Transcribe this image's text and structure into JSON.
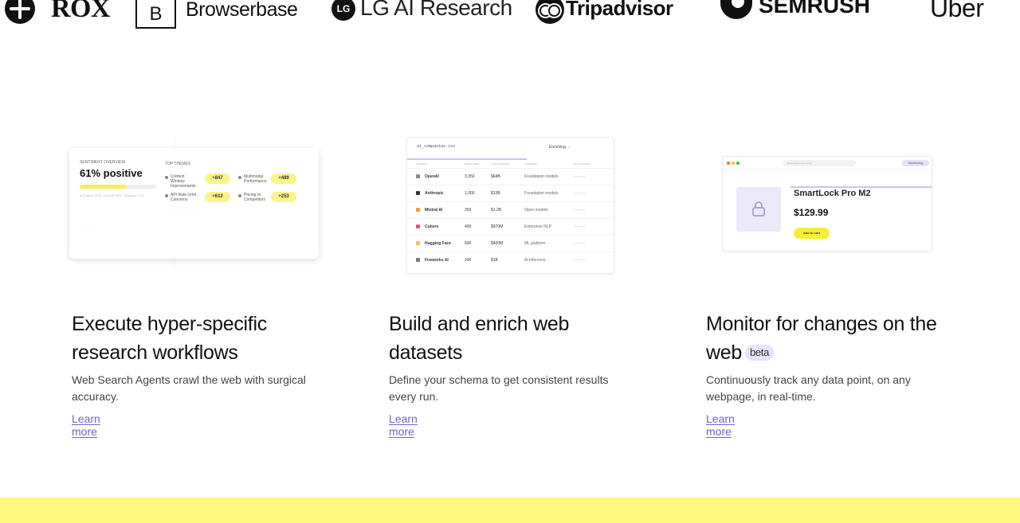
{
  "logos": [
    "ROX",
    "Browserbase",
    "LG AI Research",
    "Tripadvisor",
    "SEMRUSH",
    "Uber"
  ],
  "logo_marks": {
    "browserbase": "B",
    "lg": "LG"
  },
  "card1": {
    "overview_label": "SENTIMENT OVERVIEW",
    "headline": "61% positive",
    "sentiment_fraction": 0.61,
    "themes_label": "TOP THEMES",
    "themes": [
      {
        "label": "Context Window Improvements",
        "value": "+847"
      },
      {
        "label": "Multimodal Performance",
        "value": "+489"
      },
      {
        "label": "API Rate Limit Concerns",
        "value": "+612"
      },
      {
        "label": "Pricing vs Competitors",
        "value": "+253"
      }
    ]
  },
  "card2": {
    "filename": "ai_companies.csv",
    "status": "Enriching ...",
    "headers": [
      "COMPANY",
      "EMPLOYEES",
      "TOTAL FUNDING",
      "CATEGORY",
      "HQ LOCATION"
    ],
    "rows": [
      {
        "company": "OpenAI",
        "employees": "3,350",
        "funding": "$64B",
        "category": "Foundation models"
      },
      {
        "company": "Anthropic",
        "employees": "1,300",
        "funding": "$13B",
        "category": "Foundation models"
      },
      {
        "company": "Mistral AI",
        "employees": "250",
        "funding": "$1.2B",
        "category": "Open models"
      },
      {
        "company": "Cohere",
        "employees": "400",
        "funding": "$970M",
        "category": "Enterprise NLP"
      },
      {
        "company": "Hugging Face",
        "employees": "500",
        "funding": "$400M",
        "category": "ML platform"
      },
      {
        "company": "Fireworks AI",
        "employees": "200",
        "funding": "$1B",
        "category": "AI inference"
      }
    ]
  },
  "card3": {
    "url": "shop.electronics.com/sl",
    "monitor_label": "Monitoring",
    "product_name": "SmartLock Pro M2",
    "price": "$129.99",
    "cart_label": "Add to cart"
  },
  "features": [
    {
      "title": "Execute hyper-specific research workflows",
      "desc": "Web Search Agents crawl the web with surgical accuracy.",
      "link": "Learn more"
    },
    {
      "title": "Build and enrich web datasets",
      "desc": "Define your schema to get consistent results every run.",
      "link": "Learn more"
    },
    {
      "title": "Monitor for changes on the web",
      "badge": "beta",
      "desc": "Continuously track any data point, on any webpage, in real-time.",
      "link": "Learn more"
    }
  ],
  "colors": {
    "accent_link": "#6b66c9",
    "highlight_yellow": "#fff77f",
    "lavender": "#e6e4f6"
  }
}
